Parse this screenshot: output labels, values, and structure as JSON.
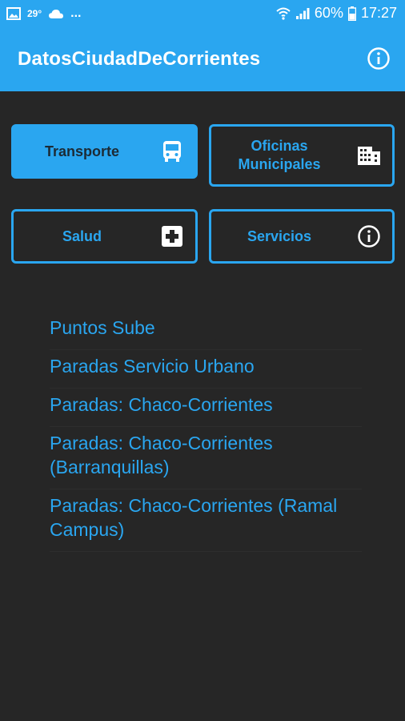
{
  "status_bar": {
    "temperature": "29°",
    "dots": "...",
    "battery": "60%",
    "time": "17:27"
  },
  "app_bar": {
    "title": "DatosCiudadDeCorrientes",
    "info_icon": "info-icon"
  },
  "categories": [
    {
      "label": "Transporte",
      "icon": "bus-icon",
      "active": true
    },
    {
      "label": "Oficinas Municipales",
      "icon": "building-icon",
      "active": false
    },
    {
      "label": "Salud",
      "icon": "medical-cross-icon",
      "active": false
    },
    {
      "label": "Servicios",
      "icon": "info-icon",
      "active": false
    }
  ],
  "transport_list": [
    "Puntos Sube",
    "Paradas Servicio Urbano",
    "Paradas: Chaco-Corrientes",
    "Paradas: Chaco-Corrientes (Barranquillas)",
    "Paradas: Chaco-Corrientes (Ramal Campus)"
  ],
  "colors": {
    "accent": "#2aa6f0",
    "background": "#262626"
  }
}
